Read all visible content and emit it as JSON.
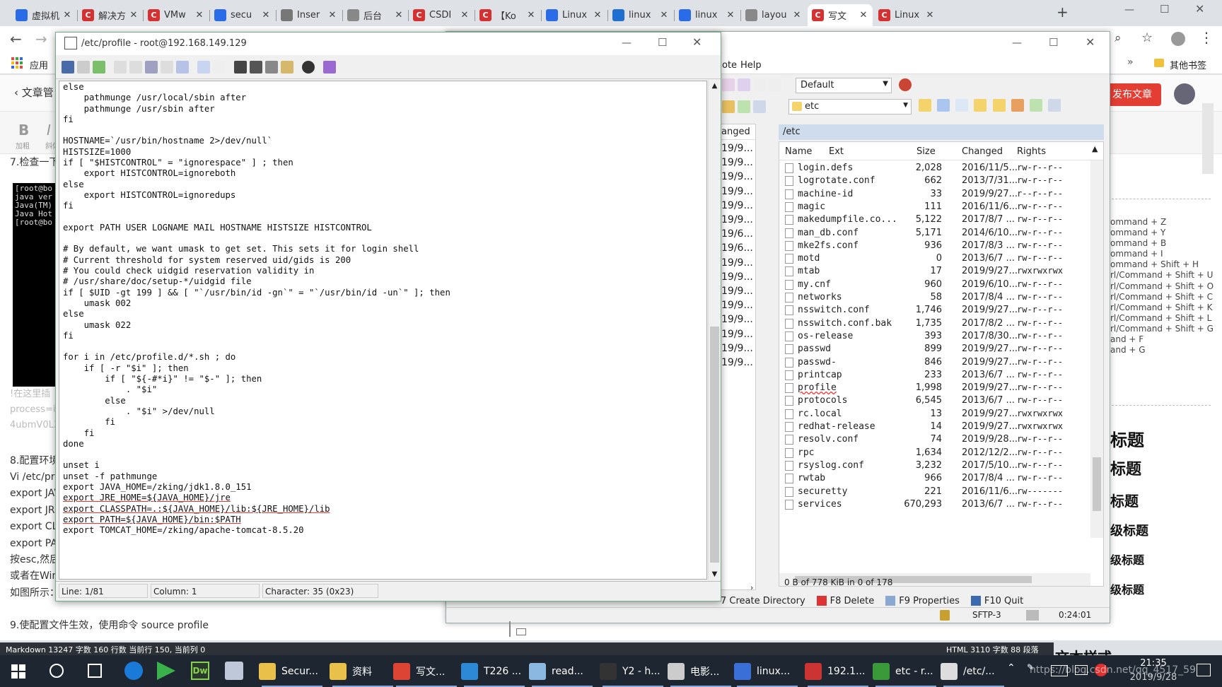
{
  "browser": {
    "tabs": [
      {
        "title": "虚拟机",
        "icon": "baidu-paw-icon",
        "color": "#2a6be8"
      },
      {
        "title": "解决方",
        "icon": "csdn-icon",
        "color": "#d63030"
      },
      {
        "title": "VMw",
        "icon": "csdn-icon",
        "color": "#d63030"
      },
      {
        "title": "secu",
        "icon": "baidu-paw-icon",
        "color": "#2a6be8"
      },
      {
        "title": "Inser",
        "icon": "image-icon",
        "color": "#777777"
      },
      {
        "title": "后台",
        "icon": "globe-icon",
        "color": "#888888"
      },
      {
        "title": "CSDI",
        "icon": "csdn-icon",
        "color": "#d63030"
      },
      {
        "title": "【Ko",
        "icon": "csdn-icon",
        "color": "#d63030"
      },
      {
        "title": "Linux",
        "icon": "baidu-paw-icon",
        "color": "#2a6be8"
      },
      {
        "title": "linux",
        "icon": "bird-icon",
        "color": "#1e6fd0"
      },
      {
        "title": "linux",
        "icon": "baidu-paw-icon",
        "color": "#2a6be8"
      },
      {
        "title": "layou",
        "icon": "globe-icon",
        "color": "#888888"
      },
      {
        "title": "写文",
        "icon": "csdn-icon",
        "color": "#d63030",
        "active": true
      },
      {
        "title": "Linux",
        "icon": "csdn-icon",
        "color": "#d63030"
      }
    ],
    "bookmarks_apps_label": "应用",
    "other_bookmarks_label": "其他书签"
  },
  "webpage": {
    "back_label": "文章管",
    "bold_label": "B",
    "bold_caption": "加粗",
    "italic_caption": "斜体",
    "publish_button": "发布文章",
    "step7": "7.检查一下",
    "terminal_lines": [
      "[root@bo",
      "java ver",
      "Java(TM)",
      "Java Hot",
      "[root@bo"
    ],
    "grey_lines": [
      "!在这里插",
      "process=i",
      "4ubmV0L3"
    ],
    "step8": "8.配置环境",
    "body_lines": [
      "Vi /etc/pro",
      "export JAV",
      "export JRE",
      "export CLA",
      "export PAT",
      "按esc,然后",
      "或者在Win",
      "如图所示："
    ],
    "step9": "9.使配置文件生效，使用命令 source profile",
    "shortcuts": [
      "ommand + Z",
      "ommand + Y",
      "ommand + B",
      "ommand + I",
      "ommand + Shift + H",
      "rl/Command + Shift + U",
      "rl/Command + Shift + O",
      "rl/Command + Shift + C",
      "rl/Command + Shift + K",
      "rl/Command + Shift + L",
      "rl/Command + Shift + G",
      "and + F",
      "and + G"
    ],
    "headings": [
      "标题",
      "标题",
      "标题",
      "级标题",
      "级标题",
      "级标题"
    ],
    "bottom_heading": "文本样式",
    "status_left": "Markdown  13247 字数  160 行数  当前行 150, 当前列 0",
    "status_right": "HTML  3110 字数  88 段落"
  },
  "winscp": {
    "menu": [
      "ote",
      "Help"
    ],
    "session_dropdown": "Default",
    "path_dropdown": "etc",
    "path_label": "/etc",
    "left_header": "anged",
    "left_dates": [
      "19/9...",
      "19/9...",
      "19/9...",
      "19/9...",
      "19/9...",
      "19/9...",
      "19/6...",
      "19/6...",
      "19/9...",
      "19/9...",
      "19/9...",
      "19/9...",
      "19/9...",
      "19/9...",
      "19/9...",
      "19/9..."
    ],
    "columns": [
      "Name",
      "Ext",
      "Size",
      "Changed",
      "Rights"
    ],
    "files": [
      {
        "name": "login.defs",
        "size": "2,028",
        "changed": "2016/11/5...",
        "rights": "rw-r--r--"
      },
      {
        "name": "logrotate.conf",
        "size": "662",
        "changed": "2013/7/31...",
        "rights": "rw-r--r--"
      },
      {
        "name": "machine-id",
        "size": "33",
        "changed": "2019/9/27...",
        "rights": "r--r--r--"
      },
      {
        "name": "magic",
        "size": "111",
        "changed": "2016/11/6...",
        "rights": "rw-r--r--"
      },
      {
        "name": "makedumpfile.co...",
        "size": "5,122",
        "changed": "2017/8/7 ...",
        "rights": "rw-r--r--"
      },
      {
        "name": "man_db.conf",
        "size": "5,171",
        "changed": "2014/6/10...",
        "rights": "rw-r--r--"
      },
      {
        "name": "mke2fs.conf",
        "size": "936",
        "changed": "2017/8/3 ...",
        "rights": "rw-r--r--"
      },
      {
        "name": "motd",
        "size": "0",
        "changed": "2013/6/7 ...",
        "rights": "rw-r--r--"
      },
      {
        "name": "mtab",
        "size": "17",
        "changed": "2019/9/27...",
        "rights": "rwxrwxrwx"
      },
      {
        "name": "my.cnf",
        "size": "960",
        "changed": "2019/6/10...",
        "rights": "rw-r--r--"
      },
      {
        "name": "networks",
        "size": "58",
        "changed": "2017/8/4 ...",
        "rights": "rw-r--r--"
      },
      {
        "name": "nsswitch.conf",
        "size": "1,746",
        "changed": "2019/9/27...",
        "rights": "rw-r--r--"
      },
      {
        "name": "nsswitch.conf.bak",
        "size": "1,735",
        "changed": "2017/8/2 ...",
        "rights": "rw-r--r--"
      },
      {
        "name": "os-release",
        "size": "393",
        "changed": "2017/8/30...",
        "rights": "rw-r--r--"
      },
      {
        "name": "passwd",
        "size": "899",
        "changed": "2019/9/27...",
        "rights": "rw-r--r--"
      },
      {
        "name": "passwd-",
        "size": "846",
        "changed": "2019/9/27...",
        "rights": "rw-r--r--"
      },
      {
        "name": "printcap",
        "size": "233",
        "changed": "2013/6/7 ...",
        "rights": "rw-r--r--"
      },
      {
        "name": "profile",
        "size": "1,998",
        "changed": "2019/9/27...",
        "rights": "rw-r--r--"
      },
      {
        "name": "protocols",
        "size": "6,545",
        "changed": "2013/6/7 ...",
        "rights": "rw-r--r--"
      },
      {
        "name": "rc.local",
        "size": "13",
        "changed": "2019/9/27...",
        "rights": "rwxrwxrwx"
      },
      {
        "name": "redhat-release",
        "size": "14",
        "changed": "2019/9/27...",
        "rights": "rwxrwxrwx"
      },
      {
        "name": "resolv.conf",
        "size": "74",
        "changed": "2019/9/28...",
        "rights": "rw-r--r--"
      },
      {
        "name": "rpc",
        "size": "1,634",
        "changed": "2012/12/2...",
        "rights": "rw-r--r--"
      },
      {
        "name": "rsyslog.conf",
        "size": "3,232",
        "changed": "2017/5/10...",
        "rights": "rw-r--r--"
      },
      {
        "name": "rwtab",
        "size": "966",
        "changed": "2017/8/4 ...",
        "rights": "rw-r--r--"
      },
      {
        "name": "securetty",
        "size": "221",
        "changed": "2016/11/6...",
        "rights": "rw-------"
      },
      {
        "name": "services",
        "size": "670,293",
        "changed": "2013/6/7 ...",
        "rights": "rw-r--r--"
      }
    ],
    "status_info": "0 B of 778 KiB in 0 of 178",
    "commands": [
      "7 Create Directory",
      "F8 Delete",
      "F9 Properties",
      "F10 Quit"
    ],
    "protocol": "SFTP-3",
    "elapsed": "0:24:01"
  },
  "editor": {
    "title": "/etc/profile - root@192.168.149.129",
    "code_lines": [
      "else",
      "    pathmunge /usr/local/sbin after",
      "    pathmunge /usr/sbin after",
      "fi",
      "",
      "HOSTNAME=`/usr/bin/hostname 2>/dev/null`",
      "HISTSIZE=1000",
      "if [ \"$HISTCONTROL\" = \"ignorespace\" ] ; then",
      "    export HISTCONTROL=ignoreboth",
      "else",
      "    export HISTCONTROL=ignoredups",
      "fi",
      "",
      "export PATH USER LOGNAME MAIL HOSTNAME HISTSIZE HISTCONTROL",
      "",
      "# By default, we want umask to get set. This sets it for login shell",
      "# Current threshold for system reserved uid/gids is 200",
      "# You could check uidgid reservation validity in",
      "# /usr/share/doc/setup-*/uidgid file",
      "if [ $UID -gt 199 ] && [ \"`/usr/bin/id -gn`\" = \"`/usr/bin/id -un`\" ]; then",
      "    umask 002",
      "else",
      "    umask 022",
      "fi",
      "",
      "for i in /etc/profile.d/*.sh ; do",
      "    if [ -r \"$i\" ]; then",
      "        if [ \"${-#*i}\" != \"$-\" ]; then",
      "            . \"$i\"",
      "        else",
      "            . \"$i\" >/dev/null",
      "        fi",
      "    fi",
      "done",
      "",
      "unset i",
      "unset -f pathmunge",
      "export JAVA_HOME=/zking/jdk1.8.0_151",
      "export JRE_HOME=${JAVA_HOME}/jre",
      "export CLASSPATH=.:${JAVA_HOME}/lib:${JRE_HOME}/lib",
      "export PATH=${JAVA_HOME}/bin:$PATH",
      "export TOMCAT_HOME=/zking/apache-tomcat-8.5.20"
    ],
    "status_line": "Line: 1/81",
    "status_column": "Column: 1",
    "status_char": "Character: 35 (0x23)"
  },
  "taskbar": {
    "apps": [
      {
        "label": "Secur...",
        "icon": "folder-icon",
        "color": "#e8c04a"
      },
      {
        "label": "资料",
        "icon": "folder-icon",
        "color": "#e8c04a"
      },
      {
        "label": "写文...",
        "icon": "chrome-icon",
        "color": "#dd4433"
      },
      {
        "label": "T226 ...",
        "icon": "app-icon",
        "color": "#2d89d6"
      },
      {
        "label": "read...",
        "icon": "notepad-icon",
        "color": "#8ab8e0"
      },
      {
        "label": "Y2 - h...",
        "icon": "gear-app-icon",
        "color": "#333333"
      },
      {
        "label": "电影...",
        "icon": "movie-icon",
        "color": "#cccccc"
      },
      {
        "label": "linux...",
        "icon": "vm-icon",
        "color": "#3a6fd8"
      },
      {
        "label": "192.1...",
        "icon": "terminal-icon",
        "color": "#cc3333"
      },
      {
        "label": "etc - r...",
        "icon": "winscp-icon",
        "color": "#3a9a3a"
      },
      {
        "label": "/etc/...",
        "icon": "editor-icon",
        "color": "#dddddd"
      }
    ],
    "time": "21:35",
    "date": "2019/9/28",
    "watermark": "https://blog.csdn.net/qq_4517_59"
  }
}
